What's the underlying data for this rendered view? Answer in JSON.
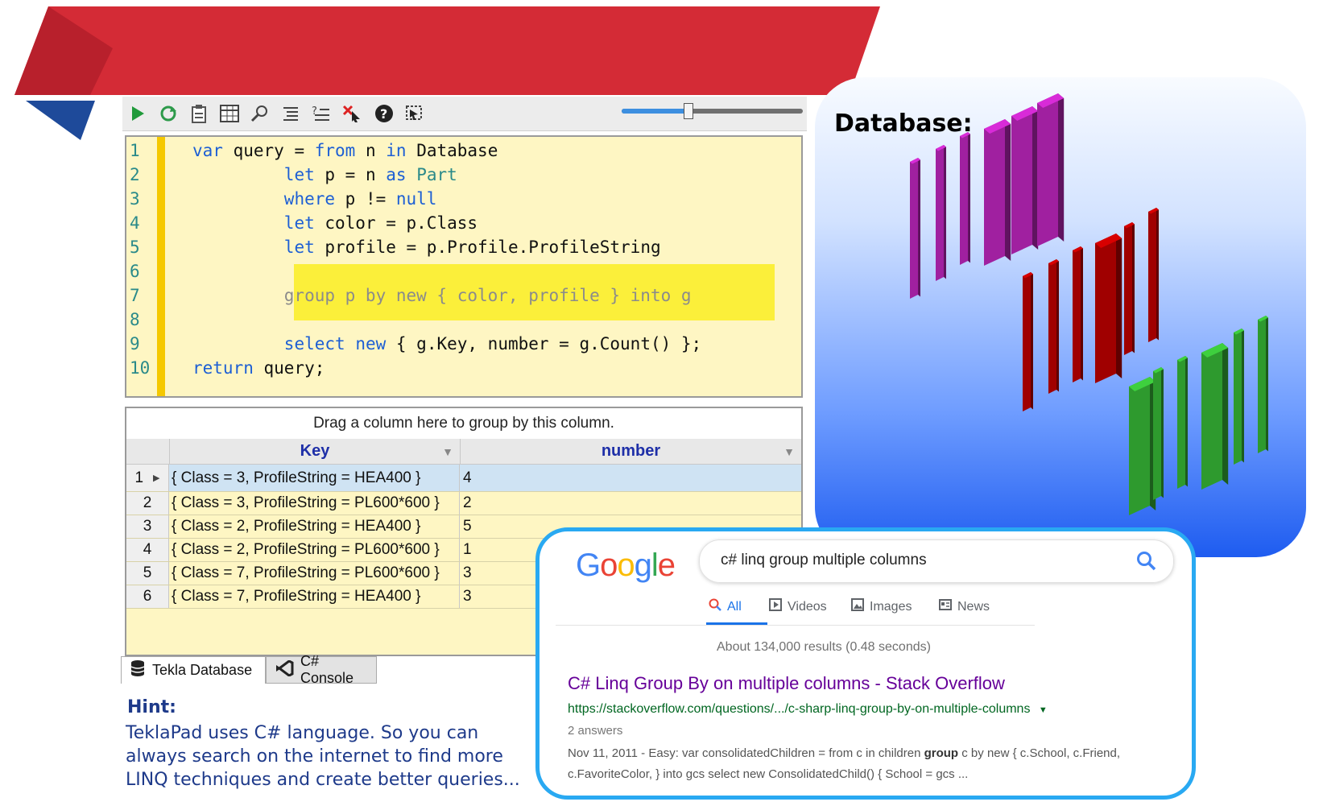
{
  "editor": {
    "toolbar_icons": [
      "run-icon",
      "refresh-icon",
      "clipboard-icon",
      "table-icon",
      "inspect-icon",
      "list-icon",
      "question-list-icon",
      "pointer-icon",
      "help-icon",
      "select-icon"
    ],
    "slider_value": 0.37,
    "line_numbers": [
      "1",
      "2",
      "3",
      "4",
      "5",
      "6",
      "7",
      "8",
      "9",
      "10"
    ]
  },
  "results": {
    "group_hint": "Drag a column here to group by this column.",
    "columns": [
      "Key",
      "number"
    ],
    "rows": [
      {
        "n": "1",
        "key": "{ Class = 3, ProfileString = HEA400 }",
        "number": "4"
      },
      {
        "n": "2",
        "key": "{ Class = 3, ProfileString = PL600*600 }",
        "number": "2"
      },
      {
        "n": "3",
        "key": "{ Class = 2, ProfileString = HEA400 }",
        "number": "5"
      },
      {
        "n": "4",
        "key": "{ Class = 2, ProfileString = PL600*600 }",
        "number": "1"
      },
      {
        "n": "5",
        "key": "{ Class = 7, ProfileString = PL600*600 }",
        "number": "3"
      },
      {
        "n": "6",
        "key": "{ Class = 7, ProfileString = HEA400 }",
        "number": "3"
      }
    ]
  },
  "tabs": {
    "tekla": "Tekla Database",
    "console": "C# Console"
  },
  "hint": {
    "title": "Hint:",
    "text": "TeklaPad uses C# language. So you can always search on the internet to find more LINQ techniques and create better queries..."
  },
  "database": {
    "title": "Database:",
    "colors": {
      "purple": "#a020a0",
      "red": "#a00000",
      "green": "#2e9a2e"
    }
  },
  "google": {
    "logo": [
      "G",
      "o",
      "o",
      "g",
      "l",
      "e"
    ],
    "logo_colors": [
      "#4285F4",
      "#EA4335",
      "#FBBC05",
      "#4285F4",
      "#34A853",
      "#EA4335"
    ],
    "query": "c# linq group multiple columns",
    "tabs": [
      "All",
      "Videos",
      "Images",
      "News"
    ],
    "stats": "About 134,000 results (0.48 seconds)",
    "result_title": "C# Linq Group By on multiple columns - Stack Overflow",
    "result_url": "https://stackoverflow.com/questions/.../c-sharp-linq-group-by-on-multiple-columns",
    "answers": "2 answers",
    "snippet_date": "Nov 11, 2011 - ",
    "snippet_a": "Easy: var consolidatedChildren = from c in children ",
    "snippet_bold": "group",
    "snippet_b": " c by new { c.School, c.Friend, c.FavoriteColor, } into gcs select new ConsolidatedChild() { School = gcs ..."
  },
  "colors": {
    "accent_red": "#d42b36",
    "accent_blue": "#1e4a9a",
    "editor_bg": "#fef6c3",
    "google_border": "#29a9f2"
  }
}
